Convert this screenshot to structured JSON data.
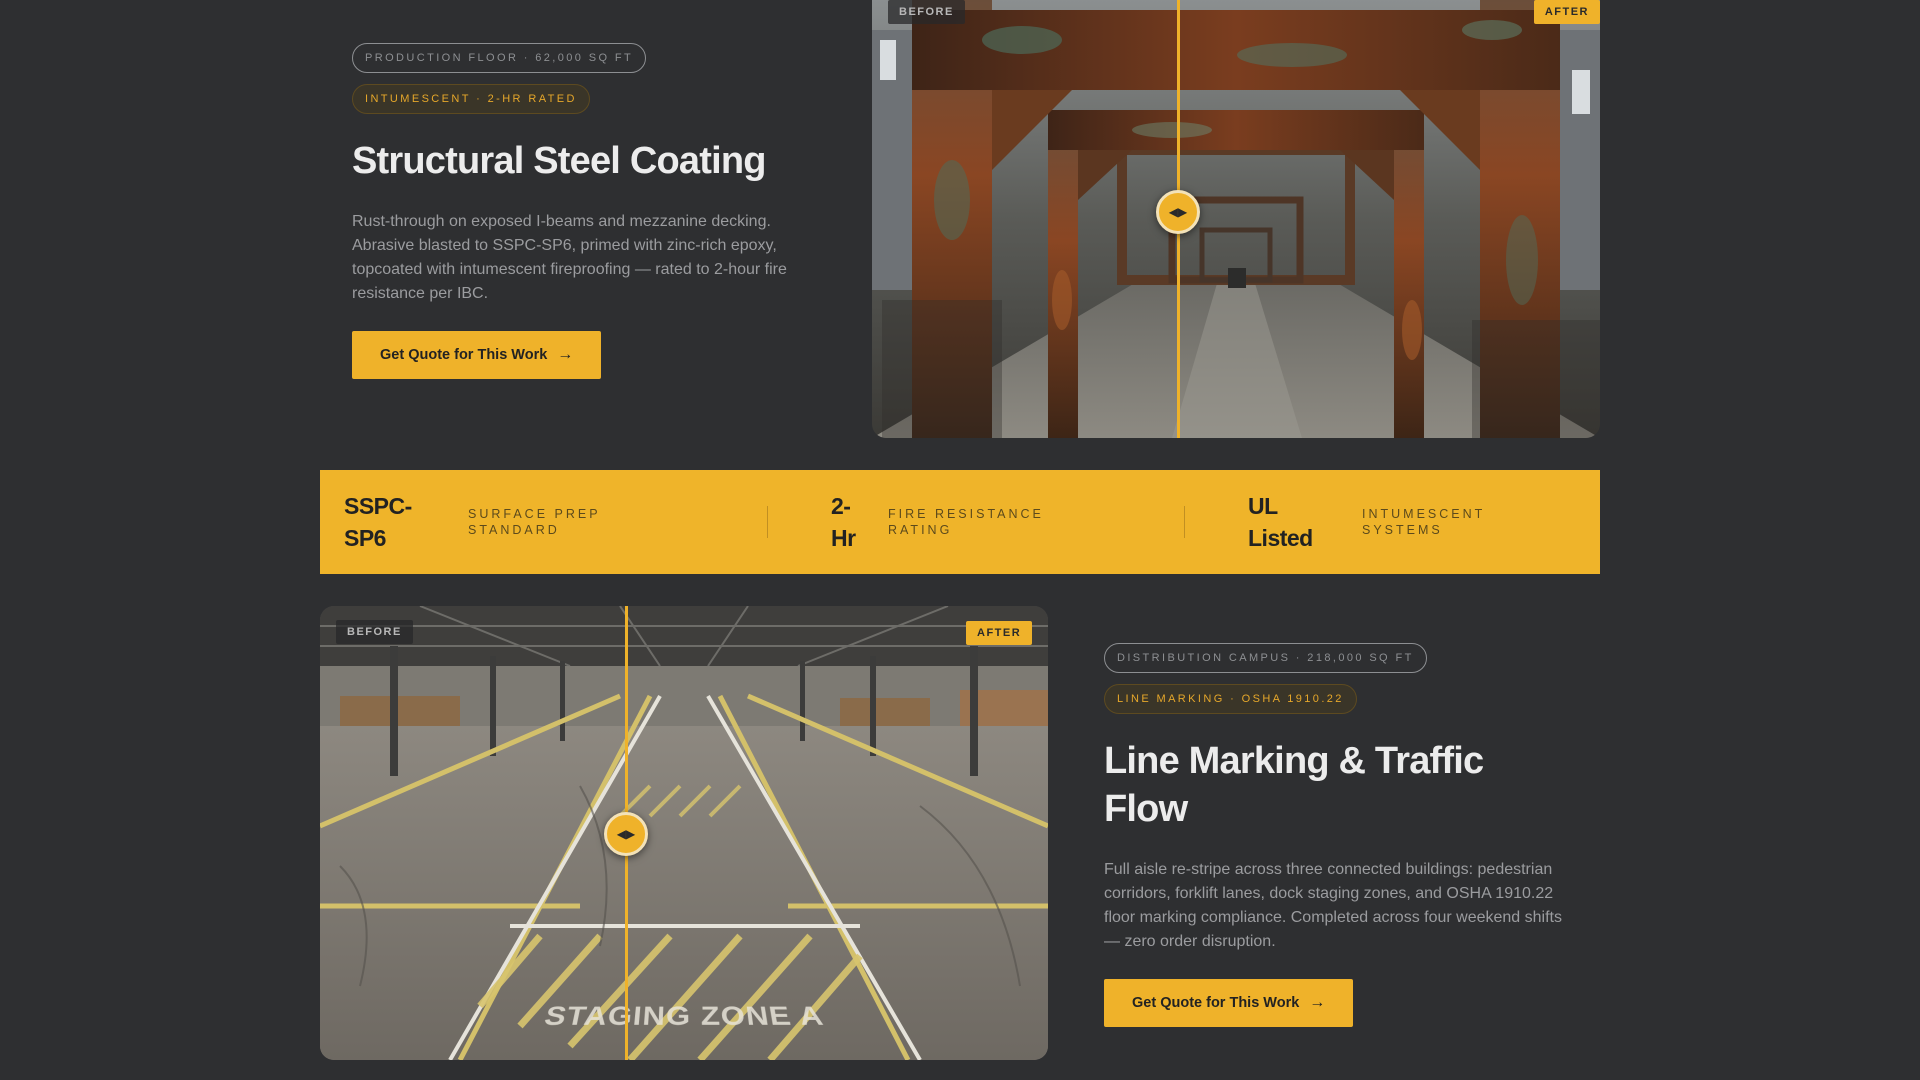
{
  "case1": {
    "meta_pill": "PRODUCTION FLOOR · 62,000 SQ FT",
    "spec_pill": "INTUMESCENT · 2-HR RATED",
    "title": "Structural Steel Coating",
    "description": "Rust-through on exposed I-beams and mezzanine decking. Abrasive blasted to SSPC-SP6, primed with zinc-rich epoxy, topcoated with intumescent fireproofing — rated to 2-hour fire resistance per IBC.",
    "cta_label": "Get Quote for This Work",
    "before_label": "BEFORE",
    "after_label": "AFTER"
  },
  "stats": [
    {
      "value_line1": "SSPC-",
      "value_line2": "SP6",
      "label_line1": "SURFACE PREP",
      "label_line2": "STANDARD"
    },
    {
      "value_line1": "2-",
      "value_line2": "Hr",
      "label_line1": "FIRE RESISTANCE",
      "label_line2": "RATING"
    },
    {
      "value_line1": "UL",
      "value_line2": "Listed",
      "label_line1": "INTUMESCENT",
      "label_line2": "SYSTEMS"
    }
  ],
  "case2": {
    "meta_pill": "DISTRIBUTION CAMPUS · 218,000 SQ FT",
    "spec_pill": "LINE MARKING · OSHA 1910.22",
    "title": "Line Marking & Traffic Flow",
    "description": "Full aisle re-stripe across three connected buildings: pedestrian corridors, forklift lanes, dock staging zones, and OSHA 1910.22 floor marking compliance. Completed across four weekend shifts — zero order disruption.",
    "cta_label": "Get Quote for This Work",
    "before_label": "BEFORE",
    "after_label": "AFTER",
    "floor_text": "STAGING ZONE A"
  },
  "icons": {
    "cta_arrow": "arrow-right-icon",
    "handle": "left-right-arrows-icon"
  },
  "colors": {
    "background": "#2e2f31",
    "accent": "#efb22a",
    "text_primary": "#ececec",
    "text_muted": "#9b9c9f"
  }
}
